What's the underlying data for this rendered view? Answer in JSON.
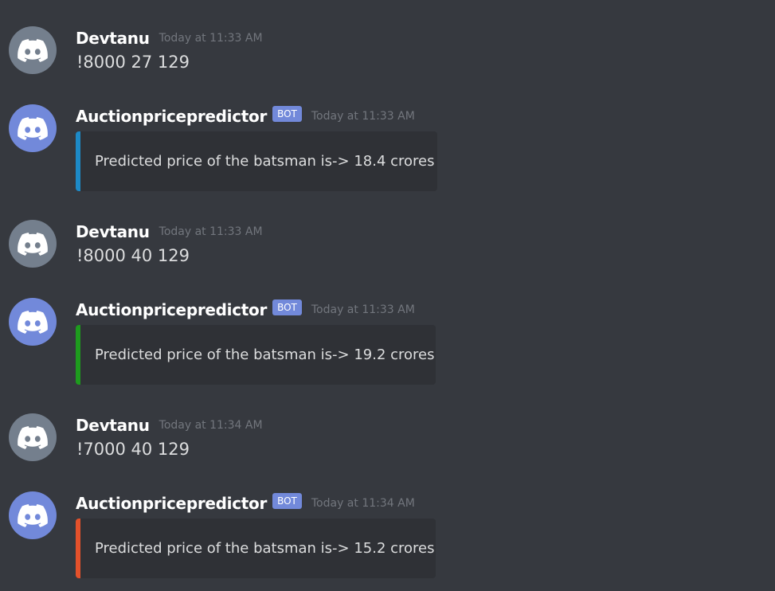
{
  "messages": [
    {
      "kind": "user",
      "author": "Devtanu",
      "timestamp": "Today at 11:33 AM",
      "avatar_icon": "discord-logo-icon",
      "avatar_color": "#747f8d",
      "text": "!8000 27 129"
    },
    {
      "kind": "bot",
      "author": "Auctionpricepredictor",
      "badge": "BOT",
      "timestamp": "Today at 11:33 AM",
      "avatar_icon": "discord-logo-icon",
      "avatar_color": "#7289da",
      "embed_color": "#1d8ac7",
      "embed_text": "Predicted price of the batsman is-> 18.4 crores"
    },
    {
      "kind": "user",
      "author": "Devtanu",
      "timestamp": "Today at 11:33 AM",
      "avatar_icon": "discord-logo-icon",
      "avatar_color": "#747f8d",
      "text": "!8000 40 129"
    },
    {
      "kind": "bot",
      "author": "Auctionpricepredictor",
      "badge": "BOT",
      "timestamp": "Today at 11:33 AM",
      "avatar_icon": "discord-logo-icon",
      "avatar_color": "#7289da",
      "embed_color": "#1e9b1e",
      "embed_text": "Predicted price of the batsman is-> 19.2 crores"
    },
    {
      "kind": "user",
      "author": "Devtanu",
      "timestamp": "Today at 11:34 AM",
      "avatar_icon": "discord-logo-icon",
      "avatar_color": "#747f8d",
      "text": "!7000 40 129"
    },
    {
      "kind": "bot",
      "author": "Auctionpricepredictor",
      "badge": "BOT",
      "timestamp": "Today at 11:34 AM",
      "avatar_icon": "discord-logo-icon",
      "avatar_color": "#7289da",
      "embed_color": "#e4512b",
      "embed_text": "Predicted price of the batsman is-> 15.2 crores"
    }
  ]
}
